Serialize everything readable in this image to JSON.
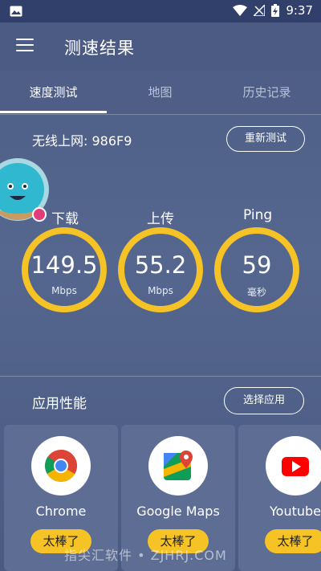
{
  "status_bar": {
    "time": "9:37",
    "icons": [
      "image-icon",
      "wifi-icon",
      "no-signal-icon",
      "battery-charging-icon"
    ]
  },
  "app_bar": {
    "title": "测速结果",
    "menu_icon": "hamburger-icon"
  },
  "tabs": [
    {
      "label": "速度测试",
      "active": true
    },
    {
      "label": "地图",
      "active": false
    },
    {
      "label": "历史记录",
      "active": false
    }
  ],
  "network": {
    "label": "无线上网: 986F9",
    "retest_label": "重新测试"
  },
  "metrics": {
    "download": {
      "label": "下载",
      "value": "149.5",
      "unit": "Mbps"
    },
    "upload": {
      "label": "上传",
      "value": "55.2",
      "unit": "Mbps"
    },
    "ping": {
      "label": "Ping",
      "value": "59",
      "unit": "毫秒"
    }
  },
  "apps_section": {
    "title": "应用性能",
    "choose_label": "选择应用",
    "apps": [
      {
        "name": "Chrome",
        "rating": "太棒了",
        "icon": "chrome-icon"
      },
      {
        "name": "Google Maps",
        "rating": "太棒了",
        "icon": "google-maps-icon"
      },
      {
        "name": "Youtube",
        "rating": "太棒了",
        "icon": "youtube-icon"
      }
    ]
  },
  "watermark": "指尖汇软件 • ZJHRJ.COM",
  "colors": {
    "accent_ring": "#f6c326",
    "background": "#4b5d85",
    "download_dot": "#e23d7b"
  }
}
